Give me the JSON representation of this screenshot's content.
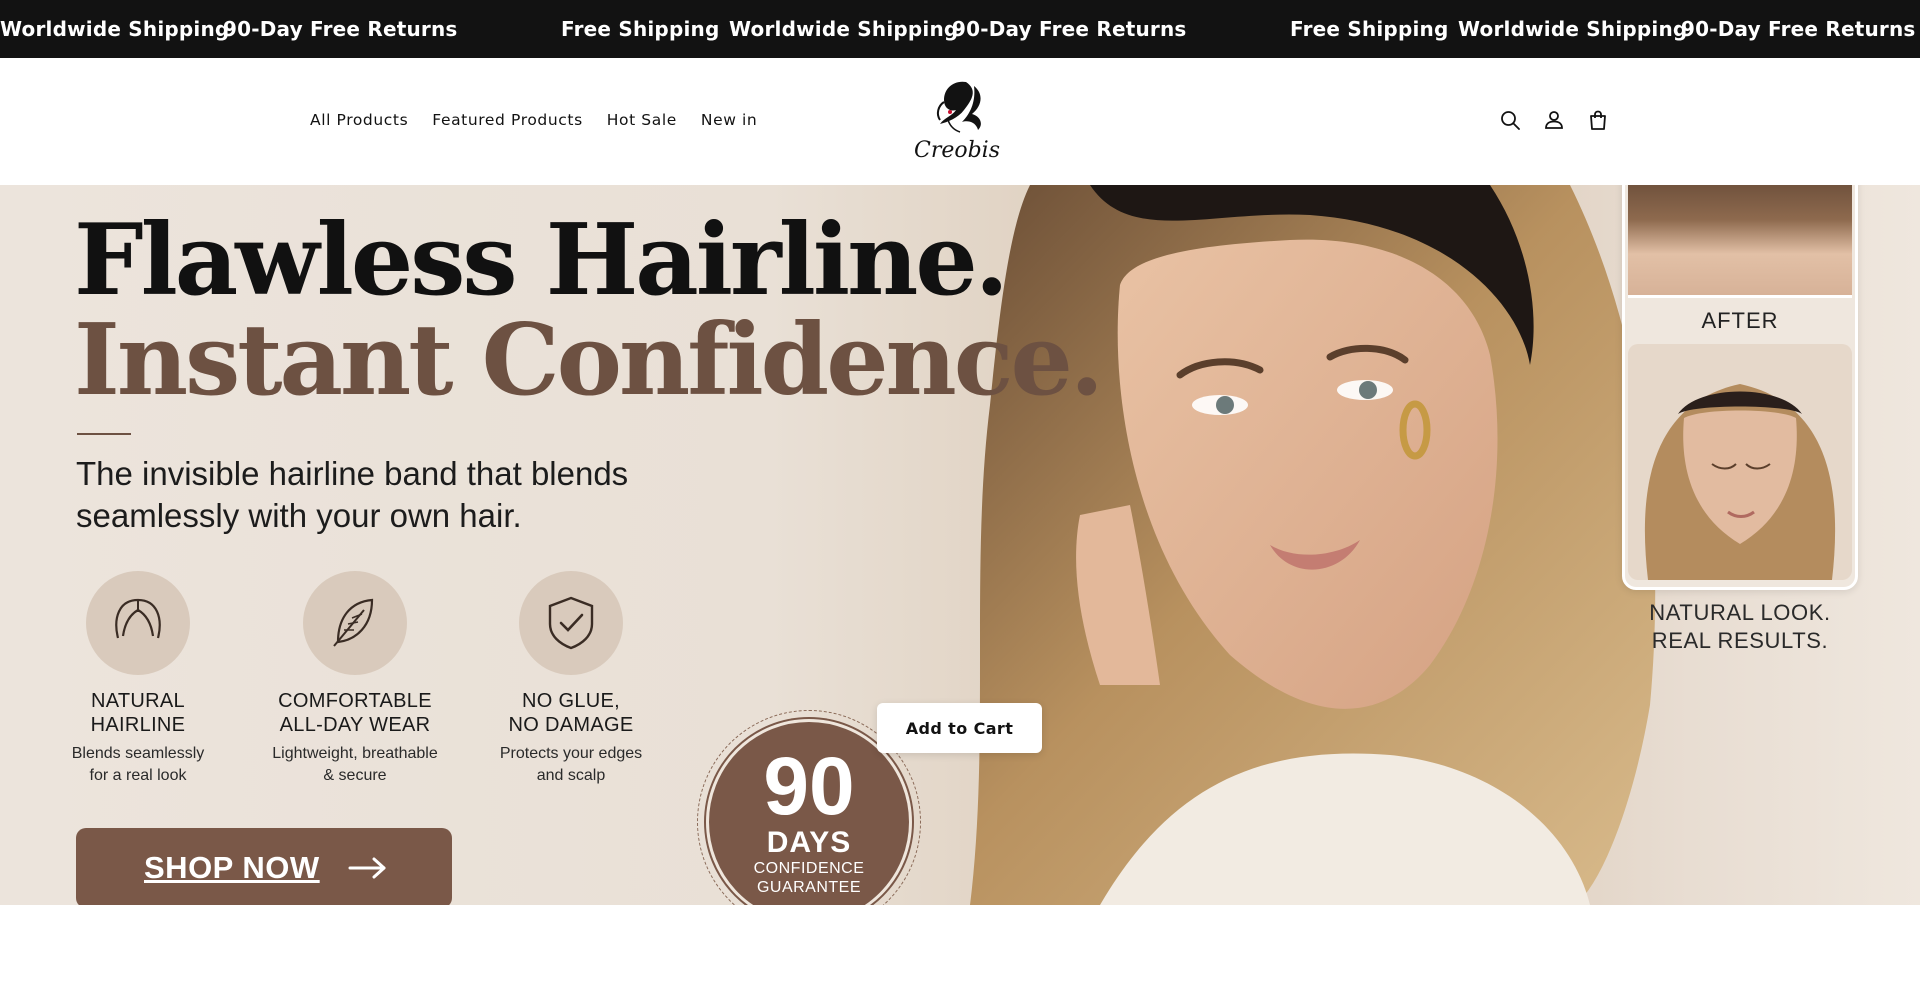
{
  "announcement": {
    "items": [
      "Worldwide Shipping",
      "90-Day Free Returns",
      "Free Shipping",
      "Worldwide Shipping",
      "90-Day Free Returns",
      "Free Shipping",
      "Worldwide Shipping",
      "90-Day Free Returns"
    ],
    "background": "#121212",
    "text_color": "#ffffff"
  },
  "header": {
    "nav": [
      "All Products",
      "Featured Products",
      "Hot Sale",
      "New in"
    ],
    "logo_text": "Creobis",
    "icons": [
      "search-icon",
      "account-icon",
      "cart-icon"
    ]
  },
  "hero": {
    "title_line1": "Flawless Hairline.",
    "title_line2": "Instant Confidence.",
    "subtitle": "The invisible hairline band that blends seamlessly with your own hair.",
    "features": [
      {
        "icon": "hairline-icon",
        "title_line1": "NATURAL",
        "title_line2": "HAIRLINE",
        "desc_line1": "Blends seamlessly",
        "desc_line2": "for a real look"
      },
      {
        "icon": "feather-icon",
        "title_line1": "COMFORTABLE",
        "title_line2": "ALL-DAY WEAR",
        "desc_line1": "Lightweight, breathable",
        "desc_line2": "& secure"
      },
      {
        "icon": "shield-check-icon",
        "title_line1": "NO GLUE,",
        "title_line2": "NO DAMAGE",
        "desc_line1": "Protects your edges",
        "desc_line2": "and scalp"
      }
    ],
    "cta_label": "SHOP NOW",
    "badge": {
      "number": "90",
      "days": "DAYS",
      "line1": "CONFIDENCE",
      "line2": "GUARANTEE"
    },
    "add_to_cart": "Add to Cart",
    "after_label": "AFTER",
    "caption_line1": "NATURAL LOOK.",
    "caption_line2": "REAL RESULTS.",
    "accent_color": "#7a5848"
  }
}
